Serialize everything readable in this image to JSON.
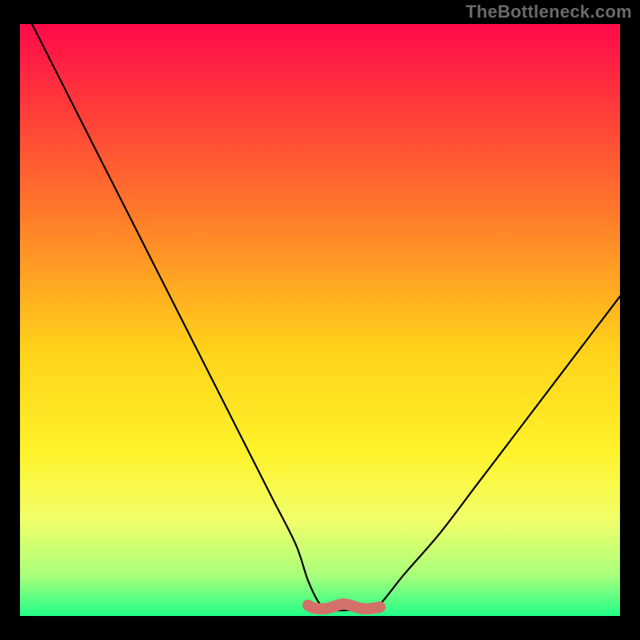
{
  "watermark": "TheBottleneck.com",
  "gradient": {
    "stops": [
      {
        "offset": "0%",
        "color": "#ff0a4a"
      },
      {
        "offset": "14%",
        "color": "#ff3a3a"
      },
      {
        "offset": "32%",
        "color": "#ff7a2a"
      },
      {
        "offset": "55%",
        "color": "#ffd21a"
      },
      {
        "offset": "72%",
        "color": "#fff22a"
      },
      {
        "offset": "84%",
        "color": "#f0ff6a"
      },
      {
        "offset": "93%",
        "color": "#aaff7a"
      },
      {
        "offset": "100%",
        "color": "#22ff88"
      }
    ]
  },
  "chart_data": {
    "type": "line",
    "title": "",
    "xlabel": "",
    "ylabel": "",
    "xlim": [
      0,
      100
    ],
    "ylim": [
      0,
      100
    ],
    "series": [
      {
        "name": "bottleneck-curve",
        "x": [
          2,
          6,
          10,
          14,
          18,
          22,
          26,
          30,
          34,
          38,
          42,
          46,
          48,
          50,
          52,
          55,
          58,
          60,
          64,
          70,
          76,
          82,
          88,
          94,
          100
        ],
        "values": [
          100,
          92,
          84,
          76,
          68,
          60,
          52,
          44,
          36,
          28,
          20,
          12,
          6,
          2,
          1,
          1,
          1,
          2,
          7,
          14,
          22,
          30,
          38,
          46,
          54
        ]
      }
    ],
    "marker_band": {
      "name": "optimal-range",
      "x_start": 48,
      "x_end": 60,
      "y": 1.5,
      "color": "#d4706a"
    }
  }
}
